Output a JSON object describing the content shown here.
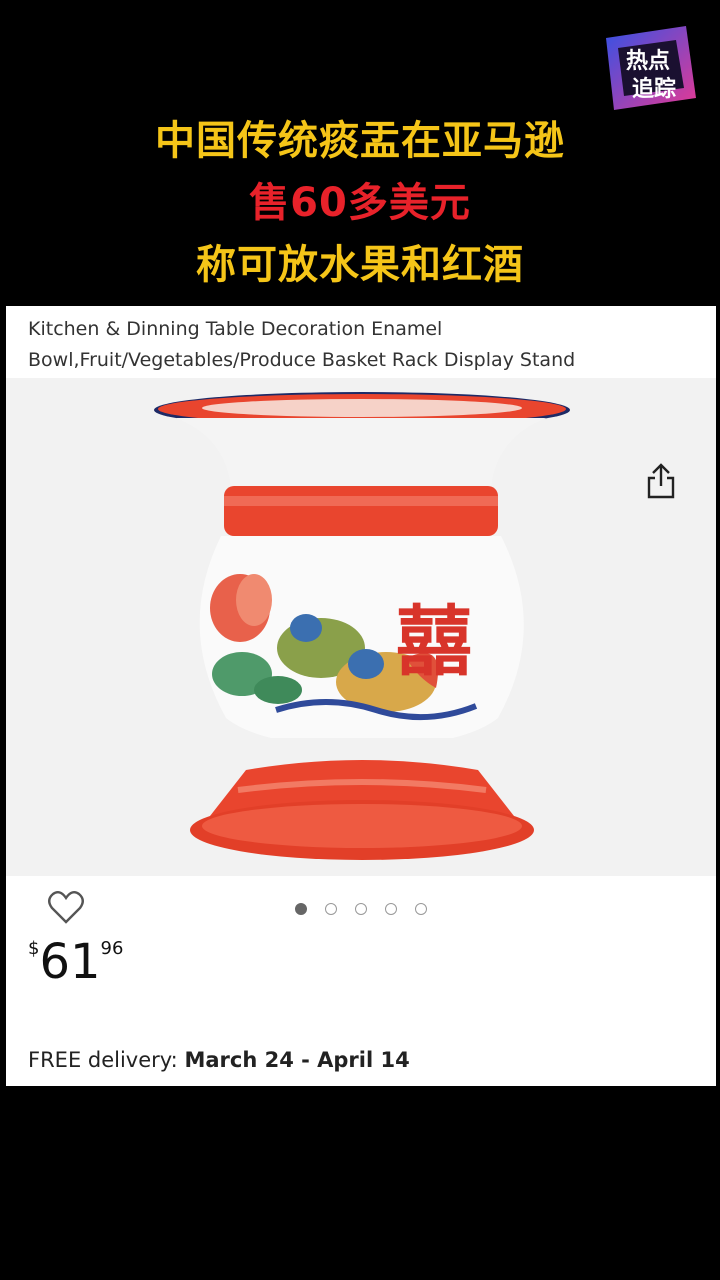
{
  "headline": {
    "line1": "中国传统痰盂在亚马逊",
    "line2": "售60多美元",
    "line3": "称可放水果和红酒"
  },
  "logo": {
    "top_text": "热点",
    "bottom_text": "追踪"
  },
  "product": {
    "title": "Kitchen & Dinning Table Decoration Enamel Bowl,Fruit/Vegetables/Produce Basket Rack Display Stand",
    "price_currency": "$",
    "price_whole": "61",
    "price_fraction": "96",
    "delivery_label": "FREE delivery:",
    "delivery_dates": "March 24 - April 14",
    "image_count": 5,
    "active_image_index": 0,
    "vase_character": "囍"
  },
  "colors": {
    "headline_yellow": "#f5c518",
    "headline_red": "#e8222a",
    "enamel_red": "#e9452e"
  }
}
